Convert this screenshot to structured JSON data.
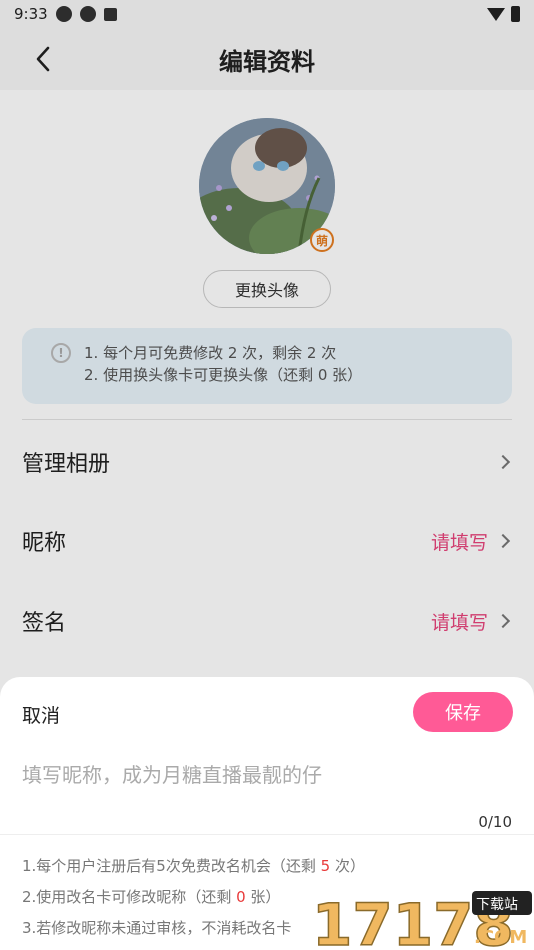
{
  "status_bar": {
    "time": "9:33"
  },
  "header": {
    "title": "编辑资料"
  },
  "avatar": {
    "badge": "萌",
    "change_button": "更换头像"
  },
  "notice": {
    "line1": "1. 每个月可免费修改 2 次，剩余 2 次",
    "line2": "2. 使用换头像卡可更换头像（还剩 0 张）"
  },
  "rows": [
    {
      "label": "管理相册",
      "value": ""
    },
    {
      "label": "昵称",
      "value": "请填写"
    },
    {
      "label": "签名",
      "value": "请填写"
    }
  ],
  "sheet": {
    "cancel": "取消",
    "save": "保存",
    "placeholder": "填写昵称，成为月糖直播最靓的仔",
    "counter": "0/10",
    "rule1_a": "1.每个用户注册后有5次免费改名机会（还剩 ",
    "rule1_num": "5",
    "rule1_b": " 次）",
    "rule2_a": "2.使用改名卡可修改昵称（还剩 ",
    "rule2_num": "0",
    "rule2_b": " 张）",
    "rule3": "3.若修改昵称未通过审核，不消耗改名卡"
  },
  "watermark": {
    "text": "17178",
    "tag": "下载站",
    "suffix": ".COM"
  },
  "colors": {
    "accent": "#ff5a96",
    "value_pink": "#e8457c",
    "highlight_red": "#e83a3a",
    "badge_orange": "#e67e22"
  }
}
